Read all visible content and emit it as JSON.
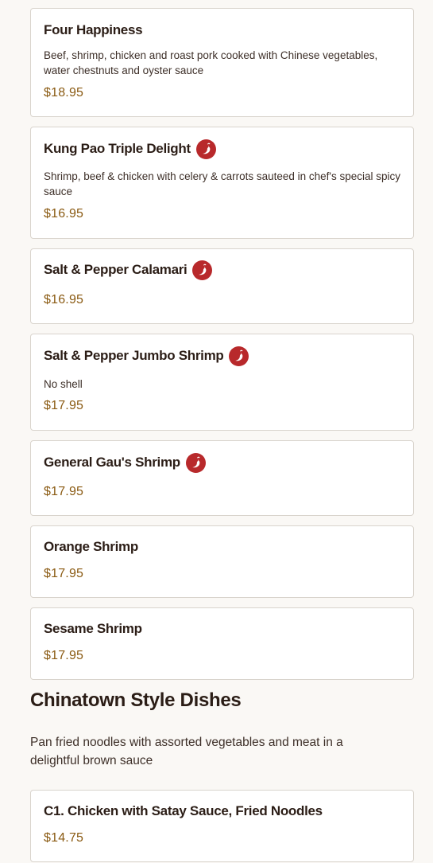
{
  "items": [
    {
      "name": "Four Happiness",
      "spicy": false,
      "description": "Beef, shrimp, chicken and roast pork cooked with Chinese vegetables, water chestnuts and oyster sauce",
      "price": "$18.95"
    },
    {
      "name": "Kung Pao Triple Delight",
      "spicy": true,
      "description": "Shrimp, beef & chicken with celery & carrots sauteed in chef's special spicy sauce",
      "price": "$16.95"
    },
    {
      "name": "Salt & Pepper Calamari",
      "spicy": true,
      "description": "",
      "price": "$16.95"
    },
    {
      "name": "Salt & Pepper Jumbo Shrimp",
      "spicy": true,
      "description": "No shell",
      "price": "$17.95"
    },
    {
      "name": "General Gau's Shrimp",
      "spicy": true,
      "description": "",
      "price": "$17.95"
    },
    {
      "name": "Orange Shrimp",
      "spicy": false,
      "description": "",
      "price": "$17.95"
    },
    {
      "name": "Sesame Shrimp",
      "spicy": false,
      "description": "",
      "price": "$17.95"
    }
  ],
  "section": {
    "title": "Chinatown Style Dishes",
    "description": "Pan fried noodles with assorted vegetables and meat in a delightful brown sauce"
  },
  "section_items": [
    {
      "name": "C1. Chicken with Satay Sauce, Fried Noodles",
      "spicy": false,
      "description": "",
      "price": "$14.75"
    }
  ],
  "colors": {
    "spicy_badge": "#b8292b",
    "price": "#8a5a12",
    "card_border": "#d9d4cd"
  },
  "icons": {
    "spicy": "chili-pepper-icon"
  }
}
